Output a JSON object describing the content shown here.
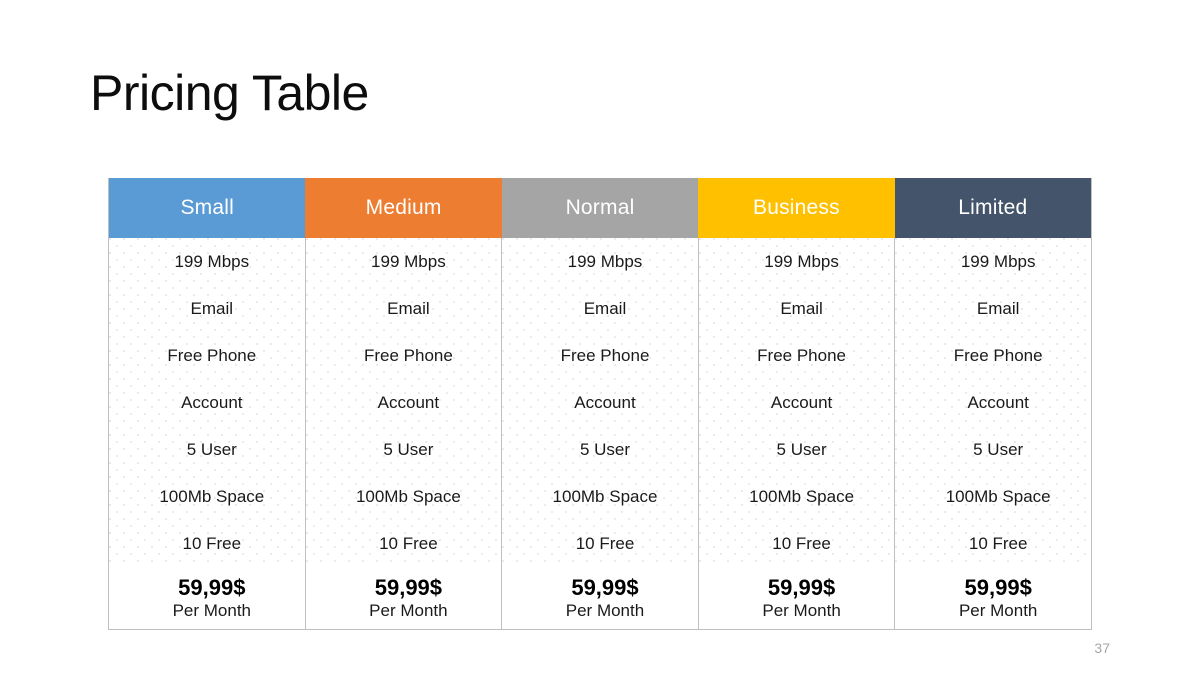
{
  "slide": {
    "title": "Pricing Table",
    "page_number": "37"
  },
  "table": {
    "columns": [
      {
        "name": "Small",
        "header_color": "#5B9BD5",
        "features": [
          "199 Mbps",
          "Email",
          "Free Phone",
          "Account",
          "5 User",
          "100Mb Space",
          "10 Free"
        ],
        "price": "59,99$",
        "period": "Per Month"
      },
      {
        "name": "Medium",
        "header_color": "#ED7D31",
        "features": [
          "199 Mbps",
          "Email",
          "Free Phone",
          "Account",
          "5 User",
          "100Mb Space",
          "10 Free"
        ],
        "price": "59,99$",
        "period": "Per Month"
      },
      {
        "name": "Normal",
        "header_color": "#A5A5A5",
        "features": [
          "199 Mbps",
          "Email",
          "Free Phone",
          "Account",
          "5 User",
          "100Mb Space",
          "10 Free"
        ],
        "price": "59,99$",
        "period": "Per Month"
      },
      {
        "name": "Business",
        "header_color": "#FFC000",
        "features": [
          "199 Mbps",
          "Email",
          "Free Phone",
          "Account",
          "5 User",
          "100Mb Space",
          "10 Free"
        ],
        "price": "59,99$",
        "period": "Per Month"
      },
      {
        "name": "Limited",
        "header_color": "#44546A",
        "features": [
          "199 Mbps",
          "Email",
          "Free Phone",
          "Account",
          "5 User",
          "100Mb Space",
          "10 Free"
        ],
        "price": "59,99$",
        "period": "Per Month"
      }
    ]
  }
}
